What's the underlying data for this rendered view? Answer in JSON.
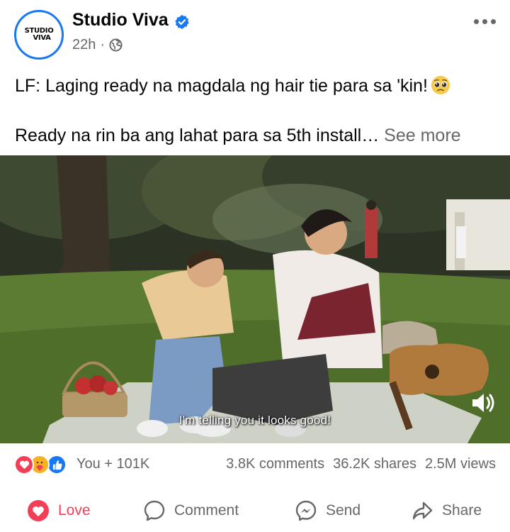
{
  "post": {
    "page_name": "Studio Viva",
    "avatar_lines": [
      "STUDIO",
      "VIVA"
    ],
    "time": "22h",
    "separator": "·",
    "caption_line1": "LF: Laging ready na magdala ng hair tie para sa 'kin!",
    "caption_line2": "Ready na rin ba ang lahat para sa 5th install…",
    "see_more": "See more"
  },
  "video": {
    "subtitle": "I'm telling you it looks good!"
  },
  "stats": {
    "reactions": [
      "love",
      "care",
      "like"
    ],
    "reactor_text": "You + 101K",
    "comments": "3.8K comments",
    "shares": "36.2K shares",
    "views": "2.5M views"
  },
  "actions": {
    "love": "Love",
    "comment": "Comment",
    "send": "Send",
    "share": "Share"
  },
  "colors": {
    "brand_blue": "#1877f2",
    "love_red": "#f33e58",
    "secondary_text": "#65676b"
  }
}
